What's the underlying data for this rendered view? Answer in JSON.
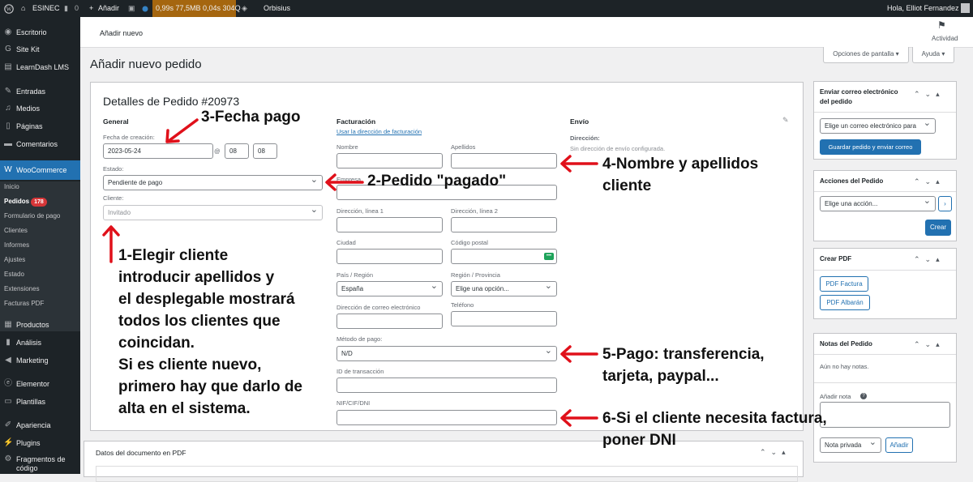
{
  "adminbar": {
    "site": "ESINEC",
    "comments": "0",
    "new": "Añadir",
    "perf": "0,99s 77,5MB 0,04s 304Q",
    "plugin": "Orbisius",
    "greeting": "Hola, Elliot Fernandez"
  },
  "sidebar": {
    "items": [
      "Escritorio",
      "Site Kit",
      "LearnDash LMS",
      "Entradas",
      "Medios",
      "Páginas",
      "Comentarios",
      "WooCommerce"
    ],
    "sub": [
      "Inicio",
      "Pedidos",
      "Formulario de pago",
      "Clientes",
      "Informes",
      "Ajustes",
      "Estado",
      "Extensiones",
      "Facturas PDF"
    ],
    "orders_badge": "178",
    "items2": [
      "Productos",
      "Análisis",
      "Marketing",
      "Elementor",
      "Plantillas",
      "Apariencia",
      "Plugins",
      "Fragmentos de código"
    ]
  },
  "topbar": {
    "title": "Añadir nuevo",
    "activity": "Actividad"
  },
  "page": {
    "title": "Añadir nuevo pedido",
    "screen_options": "Opciones de pantalla",
    "help": "Ayuda"
  },
  "order": {
    "title": "Detalles de Pedido #20973",
    "general": "General",
    "created_label": "Fecha de creación:",
    "date": "2023-05-24",
    "at": "@",
    "hour": "08",
    "minute": "08",
    "status_label": "Estado:",
    "status": "Pendiente de pago",
    "customer_label": "Cliente:",
    "customer_placeholder": "Invitado",
    "billing": "Facturación",
    "billing_link": "Usar la dirección de facturación",
    "first_name": "Nombre",
    "last_name": "Apellidos",
    "company": "Empresa",
    "addr1": "Dirección, línea 1",
    "addr2": "Dirección, línea 2",
    "city": "Ciudad",
    "postcode": "Código postal",
    "country_label": "País / Región",
    "country": "España",
    "state_label": "Región / Provincia",
    "state": "Elige una opción...",
    "email": "Dirección de correo electrónico",
    "phone": "Teléfono",
    "payment_label": "Método de pago:",
    "payment": "N/D",
    "txn": "ID de transacción",
    "nif": "NIF/CIF/DNI",
    "shipping": "Envío",
    "ship_addr_label": "Dirección:",
    "ship_addr": "Sin dirección de envío configurada."
  },
  "pdfdata": {
    "title": "Datos del documento en PDF"
  },
  "side": {
    "email_title": "Enviar correo electrónico del pedido",
    "email_select": "Elige un correo electrónico para",
    "save_send": "Guardar pedido y enviar correo",
    "actions_title": "Acciones del Pedido",
    "action_select": "Elige una acción...",
    "create": "Crear",
    "pdf_title": "Crear PDF",
    "pdf_invoice": "PDF Factura",
    "pdf_delivery": "PDF Albarán",
    "notes_title": "Notas del Pedido",
    "no_notes": "Aún no hay notas.",
    "add_note": "Añadir nota",
    "note_type": "Nota privada",
    "add": "Añadir"
  },
  "annotations": {
    "a3": "3-Fecha pago",
    "a2": "2-Pedido \"pagado\"",
    "a4": [
      "4-Nombre y apellidos",
      "cliente"
    ],
    "a1": [
      "1-Elegir cliente",
      "introducir apellidos y",
      "el desplegable mostrará",
      "todos los clientes que",
      "coincidan.",
      "Si es cliente nuevo,",
      "primero hay que darlo de",
      "alta en el sistema."
    ],
    "a5": [
      "5-Pago: transferencia,",
      "tarjeta, paypal..."
    ],
    "a6": [
      "6-Si el cliente necesita factura,",
      "poner DNI"
    ]
  },
  "colors": {
    "accent": "#2271b1",
    "annotation_arrow": "#e0101a",
    "sidebar": "#1d2327"
  }
}
